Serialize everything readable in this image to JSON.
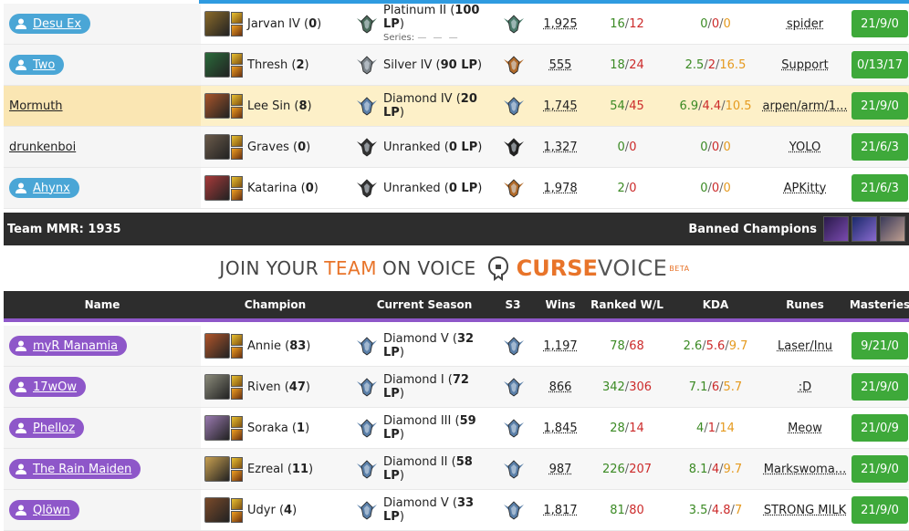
{
  "team1": {
    "players": [
      {
        "summoner": "Desu Ex",
        "style": "blue",
        "champion": "Jarvan IV",
        "games": "0",
        "tier": "Platinum II",
        "lp": "100 LP",
        "series_label": "Series:",
        "s3": "platinum",
        "wins": "1,925",
        "ranked_w": "16",
        "ranked_l": "12",
        "kda_k": "0",
        "kda_d": "0",
        "kda_a": "0",
        "runes": "spider",
        "masteries": "21/9/0",
        "tier_color": "#4a6a5a",
        "champ_color": "#8a6a2a"
      },
      {
        "summoner": "Two",
        "style": "blue",
        "champion": "Thresh",
        "games": "2",
        "tier": "Silver IV",
        "lp": "90 LP",
        "s3": "bronze",
        "wins": "555",
        "ranked_w": "18",
        "ranked_l": "24",
        "kda_k": "2.5",
        "kda_d": "2",
        "kda_a": "16.5",
        "runes": "Support",
        "masteries": "0/13/17",
        "tier_color": "#7a8288",
        "champ_color": "#2a6a3a"
      },
      {
        "summoner": "Mormuth",
        "style": "plain",
        "champion": "Lee Sin",
        "games": "8",
        "tier": "Diamond IV",
        "lp": "20 LP",
        "s3": "diamond",
        "wins": "1,745",
        "ranked_w": "54",
        "ranked_l": "45",
        "kda_k": "6.9",
        "kda_d": "4.4",
        "kda_a": "10.5",
        "runes": "arpen/arm/1...",
        "masteries": "21/9/0",
        "tier_color": "#5a7fa8",
        "champ_color": "#a8552a"
      },
      {
        "summoner": "drunkenboi",
        "style": "plain",
        "champion": "Graves",
        "games": "0",
        "tier": "Unranked",
        "lp": "0 LP",
        "s3": "unranked",
        "wins": "1,327",
        "ranked_w": "0",
        "ranked_l": "0",
        "kda_k": "0",
        "kda_d": "0",
        "kda_a": "0",
        "runes": "YOLO",
        "masteries": "21/6/3",
        "tier_color": "#333333",
        "champ_color": "#6a5a4a"
      },
      {
        "summoner": "Ahynx",
        "style": "blue",
        "champion": "Katarina",
        "games": "0",
        "tier": "Unranked",
        "lp": "0 LP",
        "s3": "bronze",
        "wins": "1,978",
        "ranked_w": "2",
        "ranked_l": "0",
        "kda_k": "0",
        "kda_d": "0",
        "kda_a": "0",
        "runes": "APKitty",
        "masteries": "21/6/3",
        "tier_color": "#333333",
        "champ_color": "#a83a3a"
      }
    ],
    "mmr_label": "Team MMR: 1935",
    "banned_label": "Banned Champions"
  },
  "promo": {
    "part1": "JOIN YOUR",
    "part2": "TEAM",
    "part3": "ON VOICE",
    "brand_a": "CURSE",
    "brand_b": "VOICE",
    "beta": "BETA"
  },
  "header": {
    "name": "Name",
    "champion": "Champion",
    "season": "Current Season",
    "s3": "S3",
    "wins": "Wins",
    "ranked": "Ranked W/L",
    "kda": "KDA",
    "runes": "Runes",
    "masteries": "Masteries"
  },
  "team2": {
    "players": [
      {
        "summoner": "myR Manamia",
        "style": "purple",
        "champion": "Annie",
        "games": "83",
        "tier": "Diamond V",
        "lp": "32 LP",
        "s3": "diamond",
        "wins": "1,197",
        "ranked_w": "78",
        "ranked_l": "68",
        "kda_k": "2.6",
        "kda_d": "5.6",
        "kda_a": "9.7",
        "runes": "Laser/Inu",
        "masteries": "9/21/0",
        "tier_color": "#5a7fa8",
        "champ_color": "#b0552a"
      },
      {
        "summoner": "17wOw",
        "style": "purple",
        "champion": "Riven",
        "games": "47",
        "tier": "Diamond I",
        "lp": "72 LP",
        "s3": "diamond",
        "wins": "866",
        "ranked_w": "342",
        "ranked_l": "306",
        "kda_k": "7.1",
        "kda_d": "6",
        "kda_a": "5.7",
        "runes": ":D",
        "masteries": "21/9/0",
        "tier_color": "#5a7fa8",
        "champ_color": "#8a8a7a"
      },
      {
        "summoner": "Phelloz",
        "style": "purple",
        "champion": "Soraka",
        "games": "1",
        "tier": "Diamond III",
        "lp": "59 LP",
        "s3": "diamond",
        "wins": "1,845",
        "ranked_w": "28",
        "ranked_l": "14",
        "kda_k": "4",
        "kda_d": "1",
        "kda_a": "14",
        "runes": "Meow",
        "masteries": "21/0/9",
        "tier_color": "#5a7fa8",
        "champ_color": "#9a7ab0"
      },
      {
        "summoner": "The Rain Maiden",
        "style": "purple",
        "champion": "Ezreal",
        "games": "11",
        "tier": "Diamond II",
        "lp": "58 LP",
        "s3": "diamond",
        "wins": "987",
        "ranked_w": "226",
        "ranked_l": "207",
        "kda_k": "8.1",
        "kda_d": "4",
        "kda_a": "9.7",
        "runes": "Markswoma...",
        "masteries": "21/9/0",
        "tier_color": "#5a7fa8",
        "champ_color": "#c8a050"
      },
      {
        "summoner": "Qlöwn",
        "style": "purple",
        "champion": "Udyr",
        "games": "4",
        "tier": "Diamond V",
        "lp": "33 LP",
        "s3": "diamond",
        "wins": "1,817",
        "ranked_w": "81",
        "ranked_l": "80",
        "kda_k": "3.5",
        "kda_d": "4.8",
        "kda_a": "7",
        "runes": "STRONG MILK",
        "masteries": "21/9/0",
        "tier_color": "#5a7fa8",
        "champ_color": "#7a4a2a"
      }
    ]
  },
  "colors": {
    "team_blue": "#4aa6d6",
    "team_purple": "#8e57c9",
    "masteries_green": "#3ea93a",
    "win_green": "#3b8a24",
    "loss_red": "#cc2b2b",
    "assist_orange": "#e59a1f",
    "highlight": "#fdf0c8"
  }
}
